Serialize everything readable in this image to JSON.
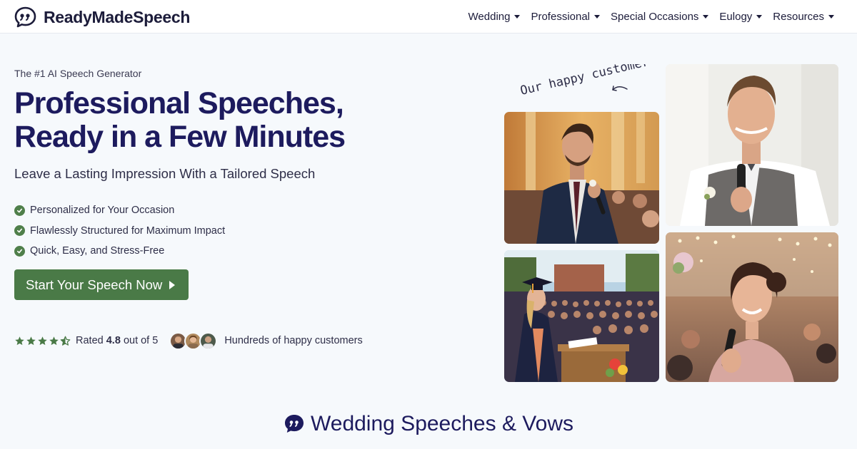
{
  "brand": {
    "name": "ReadyMadeSpeech",
    "icon": "speech-quote-icon",
    "color": "#1c1c3a"
  },
  "nav": {
    "items": [
      {
        "label": "Wedding"
      },
      {
        "label": "Professional"
      },
      {
        "label": "Special Occasions"
      },
      {
        "label": "Eulogy"
      },
      {
        "label": "Resources"
      }
    ]
  },
  "hero": {
    "eyebrow": "The #1 AI Speech Generator",
    "headline_line1": "Professional Speeches,",
    "headline_line2": "Ready in a Few Minutes",
    "subhead": "Leave a Lasting Impression With a Tailored Speech",
    "features": [
      {
        "label": "Personalized for Your Occasion"
      },
      {
        "label": "Flawlessly Structured for Maximum Impact"
      },
      {
        "label": "Quick, Easy, and Stress-Free"
      }
    ],
    "cta_label": "Start Your Speech Now",
    "rating": {
      "prefix": "Rated",
      "value": "4.8",
      "suffix": "out of 5",
      "stars": 4.5,
      "happy_customers": "Hundreds of happy customers"
    }
  },
  "gallery": {
    "annotation": "Our happy customers"
  },
  "section": {
    "title": "Wedding Speeches & Vows",
    "icon": "speech-bubble-icon"
  },
  "colors": {
    "accent_green": "#4a7a47",
    "headline_navy": "#1d1b5e",
    "background": "#f6f9fc"
  }
}
